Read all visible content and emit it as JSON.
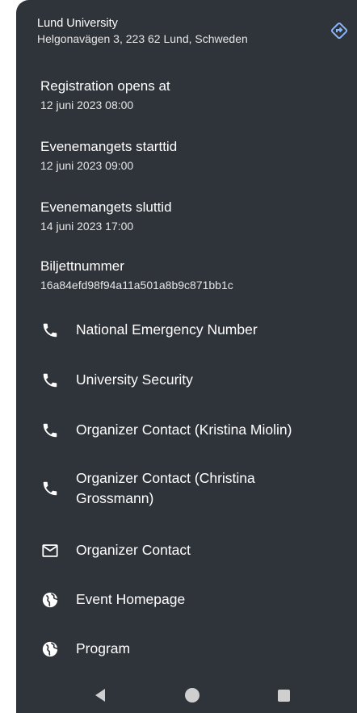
{
  "location": {
    "name": "Lund University",
    "address": "Helgonavägen 3, 223 62 Lund, Schweden",
    "directions_icon": "directions-icon"
  },
  "details": [
    {
      "label": "Registration opens at",
      "value": "12 juni 2023 08:00"
    },
    {
      "label": "Evenemangets starttid",
      "value": "12 juni 2023 09:00"
    },
    {
      "label": "Evenemangets sluttid",
      "value": "14 juni 2023 17:00"
    },
    {
      "label": "Biljettnummer",
      "value": "16a84efd98f94a11a501a8b9c871bb1c"
    }
  ],
  "contacts": [
    {
      "icon": "phone-icon",
      "label": "National Emergency Number"
    },
    {
      "icon": "phone-icon",
      "label": "University Security"
    },
    {
      "icon": "phone-icon",
      "label": "Organizer Contact (Kristina Miolin)"
    },
    {
      "icon": "phone-icon",
      "label": "Organizer Contact (Christina Grossmann)"
    },
    {
      "icon": "mail-icon",
      "label": "Organizer Contact"
    },
    {
      "icon": "globe-icon",
      "label": "Event Homepage"
    },
    {
      "icon": "globe-icon",
      "label": "Program"
    }
  ],
  "navbar": {
    "back": "back-icon",
    "home": "home-icon",
    "recents": "recents-icon"
  },
  "colors": {
    "background": "#2f333a",
    "accent": "#8ab4f8",
    "text": "#ffffff"
  }
}
